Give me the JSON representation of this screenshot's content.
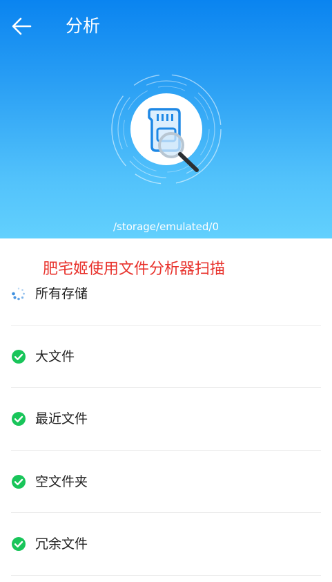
{
  "header": {
    "title": "分析",
    "back_icon": "arrow-left-icon"
  },
  "scan": {
    "path": "/storage/emulated/0",
    "icon": "sd-card-magnifier-icon"
  },
  "overlay_text": "肥宅姬使用文件分析器扫描",
  "items": [
    {
      "label": "所有存储",
      "status": "loading"
    },
    {
      "label": "大文件",
      "status": "done"
    },
    {
      "label": "最近文件",
      "status": "done"
    },
    {
      "label": "空文件夹",
      "status": "done"
    },
    {
      "label": "冗余文件",
      "status": "done"
    }
  ],
  "colors": {
    "accent_green": "#19c55a",
    "loading_blue": "#3c8fe0",
    "overlay_red": "#e8312b"
  }
}
